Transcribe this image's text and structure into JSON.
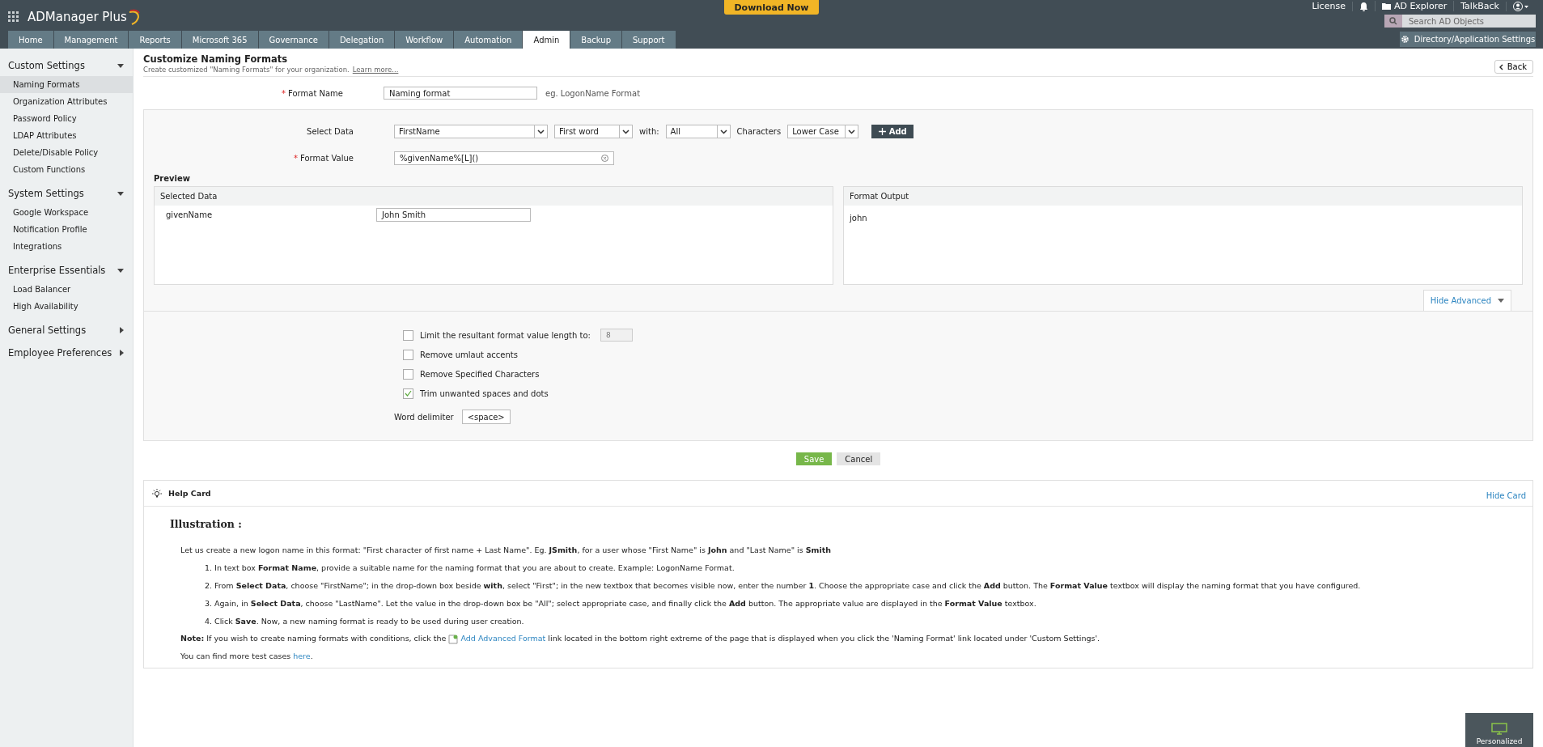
{
  "header": {
    "product": "ADManager Plus",
    "download_button": "Download Now",
    "links": [
      "License",
      "AD Explorer",
      "TalkBack"
    ],
    "search": {
      "placeholder": "Search AD Objects"
    },
    "tabs": [
      {
        "label": "Home",
        "selected": false
      },
      {
        "label": "Management",
        "selected": false
      },
      {
        "label": "Reports",
        "selected": false
      },
      {
        "label": "Microsoft 365",
        "selected": false
      },
      {
        "label": "Governance",
        "selected": false
      },
      {
        "label": "Delegation",
        "selected": false
      },
      {
        "label": "Workflow",
        "selected": false
      },
      {
        "label": "Automation",
        "selected": false
      },
      {
        "label": "Admin",
        "selected": true
      },
      {
        "label": "Backup",
        "selected": false
      },
      {
        "label": "Support",
        "selected": false
      }
    ],
    "settings_button": "Directory/Application Settings"
  },
  "sidebar": {
    "sections": [
      {
        "title": "Custom Settings",
        "expanded": true,
        "items": [
          {
            "label": "Naming Formats",
            "selected": true
          },
          {
            "label": "Organization Attributes",
            "selected": false
          },
          {
            "label": "Password Policy",
            "selected": false
          },
          {
            "label": "LDAP Attributes",
            "selected": false
          },
          {
            "label": "Delete/Disable Policy",
            "selected": false
          },
          {
            "label": "Custom Functions",
            "selected": false
          }
        ]
      },
      {
        "title": "System Settings",
        "expanded": true,
        "items": [
          {
            "label": "Google Workspace",
            "selected": false
          },
          {
            "label": "Notification Profile",
            "selected": false
          },
          {
            "label": "Integrations",
            "selected": false
          }
        ]
      },
      {
        "title": "Enterprise Essentials",
        "expanded": true,
        "items": [
          {
            "label": "Load Balancer",
            "selected": false
          },
          {
            "label": "High Availability",
            "selected": false
          }
        ]
      },
      {
        "title": "General Settings",
        "expanded": false
      },
      {
        "title": "Employee Preferences",
        "expanded": false
      }
    ]
  },
  "page": {
    "title": "Customize Naming Formats",
    "subtitle": "Create customized \"Naming Formats\" for your organization.",
    "learn_more": "Learn more...",
    "back_button": "Back"
  },
  "form": {
    "required_mark": "*",
    "format_name": {
      "label": "Format Name",
      "required": true,
      "value": "Naming format",
      "hint": "eg. LogonName Format"
    },
    "select_data": {
      "label": "Select Data",
      "required": false,
      "attribute": "FirstName",
      "part": "First word",
      "with_label": "with:",
      "with": "All",
      "characters_label": "Characters",
      "case": "Lower Case",
      "add_button": "Add"
    },
    "format_value": {
      "label": "Format Value",
      "required": true,
      "value": "%givenName%[L]()"
    }
  },
  "preview": {
    "title": "Preview",
    "selected_data": {
      "heading": "Selected Data",
      "rows": [
        {
          "name": "givenName",
          "value": "John Smith"
        }
      ]
    },
    "format_output": {
      "heading": "Format Output",
      "value": "john"
    }
  },
  "advanced": {
    "toggle": "Hide Advanced",
    "expanded": true,
    "options": [
      {
        "label": "Limit the resultant format value length to:",
        "checked": false,
        "value": "8",
        "disabled": true
      },
      {
        "label": "Remove umlaut accents",
        "checked": false
      },
      {
        "label": "Remove Specified Characters",
        "checked": false
      },
      {
        "label": "Trim unwanted spaces and dots",
        "checked": true
      }
    ],
    "delimiter": {
      "label": "Word delimiter",
      "value": "<space>"
    }
  },
  "actions": [
    {
      "label": "Save",
      "kind": "primary"
    },
    {
      "label": "Cancel",
      "kind": "secondary"
    }
  ],
  "help_card": {
    "title": "Help Card",
    "hide_link": "Hide Card",
    "heading": "Illustration :",
    "intro": "Let us create a new logon name in this format: \"First character of first name + Last Name\". Eg. **JSmith**, for a user whose \"First Name\" is **John** and \"Last Name\" is **Smith**",
    "steps": [
      "1. In text box **Format Name**, provide a suitable name for the naming format that you are about to create. Example: LogonName Format.",
      "2. From **Select Data**, choose \"FirstName\"; in the drop-down box beside **with**, select \"First\"; in the new textbox that becomes visible now, enter the number **1**. Choose the appropriate case and click the **Add** button. The **Format Value** textbox will display the naming format that you have configured.",
      "3. Again, in **Select Data**, choose \"LastName\". Let the value in the drop-down box be \"All\"; select appropriate case, and finally click the **Add** button. The appropriate value are displayed in the **Format Value** textbox.",
      "4. Click **Save**. Now, a new naming format is ready to be used during user creation."
    ],
    "note_before": "**Note:** If you wish to create naming formats with conditions, click the",
    "note_link": "Add Advanced Format",
    "note_after": "link located in the bottom right extreme of the page that is displayed when you click the 'Naming Format' link located under 'Custom Settings'.",
    "more_before": "You can find more test cases",
    "more_link": "here",
    "more_after": "."
  },
  "widget": {
    "label": "Personalized"
  }
}
